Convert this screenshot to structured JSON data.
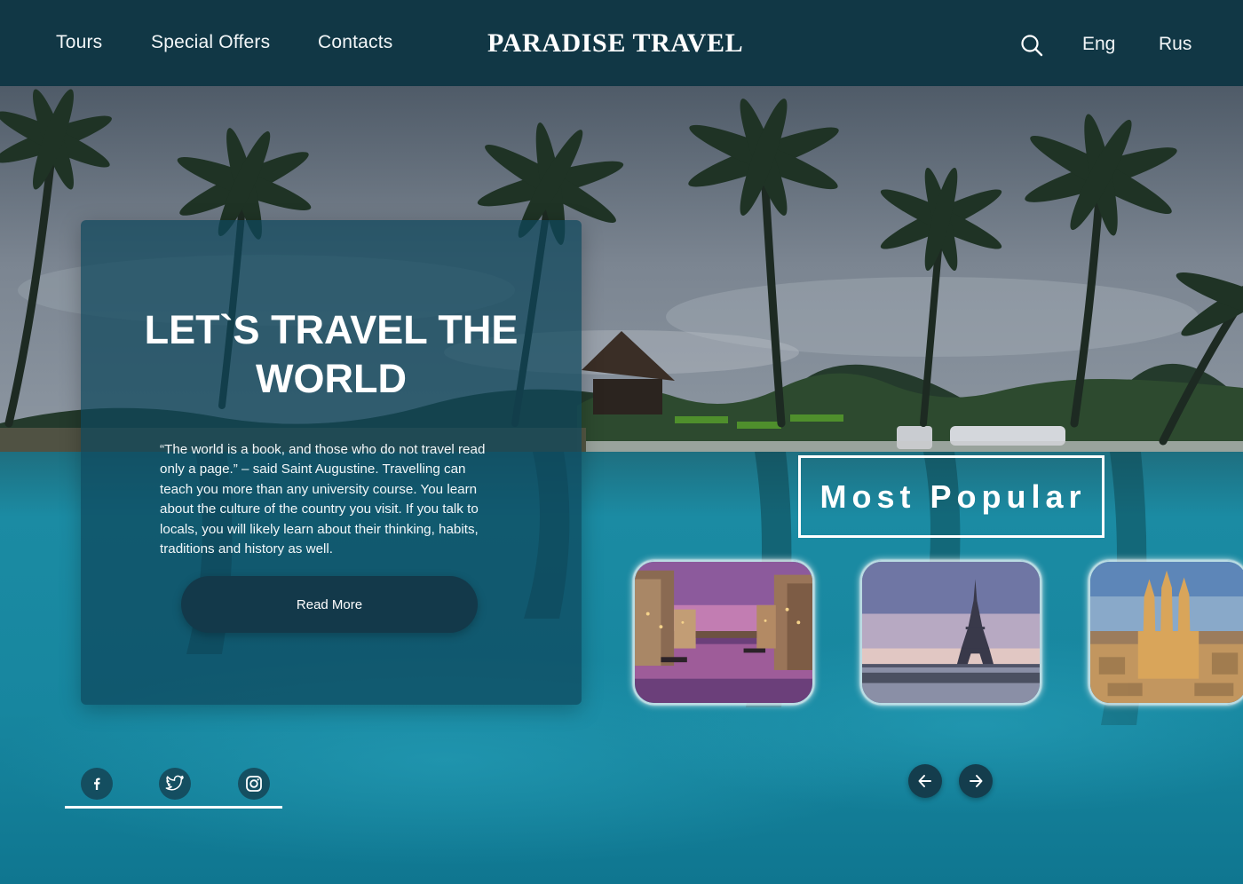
{
  "header": {
    "nav": [
      "Tours",
      "Special Offers",
      "Contacts"
    ],
    "logo": "PARADISE TRAVEL",
    "search_icon": "search-icon",
    "languages": [
      "Eng",
      "Rus"
    ]
  },
  "intro": {
    "title": "LET`S TRAVEL THE WORLD",
    "text": "“The world is a book, and those who do not travel read only a page.” – said Saint Augustine. Travelling can teach you more than any university course. You learn about the culture of the country you visit. If you talk to locals, you will likely learn about their thinking, habits, traditions and history as well.",
    "button": "Read More"
  },
  "popular": {
    "title": "Most Popular",
    "destinations": [
      "venice-canal-image",
      "eiffel-tower-image",
      "sagrada-familia-image"
    ],
    "prev_icon": "arrow-left-icon",
    "next_icon": "arrow-right-icon"
  },
  "social": {
    "icons": [
      "facebook-icon",
      "twitter-icon",
      "instagram-icon"
    ]
  },
  "colors": {
    "header_bg": "#113745",
    "card_bg": "#0e465c",
    "button_bg": "#13394a",
    "water": "#1c8aa1"
  }
}
